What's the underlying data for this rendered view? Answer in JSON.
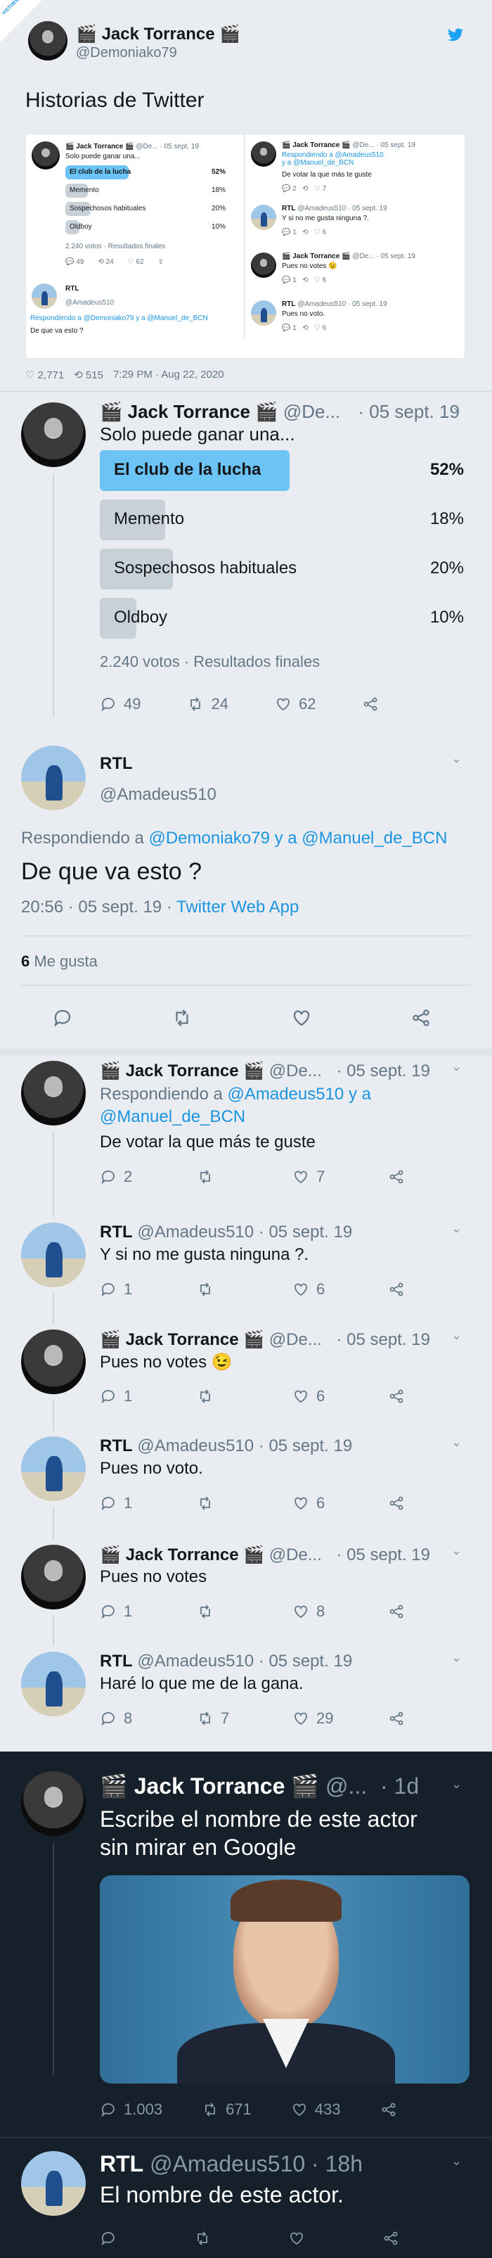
{
  "header": {
    "name": "Jack Torrance",
    "handle": "@Demoniako79",
    "title": "Historias de Twitter",
    "watermark": "VISTOENLASREDES"
  },
  "mini": {
    "left": {
      "name": "Jack Torrance",
      "handle": "@De...",
      "date": "· 05 sept. 19",
      "text": "Solo puede ganar una...",
      "opts": [
        "El club de la lucha",
        "Memento",
        "Sospechosos habituales",
        "Oldboy"
      ],
      "pcts": [
        "52%",
        "18%",
        "20%",
        "10%"
      ],
      "votes": "2.240 votos · Resultados finales",
      "r": "49",
      "rt": "24",
      "l": "62",
      "rtl_name": "RTL",
      "rtl_handle": "@Amadeus510",
      "reply_to": "Respondiendo a @Demoniako79 y a @Manuel_de_BCN",
      "reply_text": "De que va esto ?"
    },
    "right": [
      {
        "name": "Jack Torrance",
        "handle": "@De...",
        "date": "· 05 sept. 19",
        "reply": "Respondiendo a @Amadeus510 y a @Manuel_de_BCN",
        "text": "De votar la que más te guste",
        "r": "2",
        "l": "7"
      },
      {
        "name": "RTL",
        "handle": "@Amadeus510 · 05 sept. 19",
        "text": "Y si no me gusta ninguna ?.",
        "r": "1",
        "l": "6"
      },
      {
        "name": "Jack Torrance",
        "handle": "@De...",
        "date": "· 05 sept. 19",
        "text": "Pues no votes 😉",
        "r": "1",
        "l": "6"
      },
      {
        "name": "RTL",
        "handle": "@Amadeus510 · 05 sept. 19",
        "text": "Pues no voto.",
        "r": "1",
        "l": "6"
      }
    ],
    "stats": {
      "likes": "2,771",
      "rts": "515",
      "time": "7:29 PM · Aug 22, 2020"
    }
  },
  "main_tweet": {
    "name": "Jack Torrance",
    "handle": "@De...",
    "date": "· 05 sept. 19",
    "text": "Solo puede ganar una...",
    "poll": [
      {
        "label": "El club de la lucha",
        "pct": "52%",
        "value": 52
      },
      {
        "label": "Memento",
        "pct": "18%",
        "value": 18
      },
      {
        "label": "Sospechosos habituales",
        "pct": "20%",
        "value": 20
      },
      {
        "label": "Oldboy",
        "pct": "10%",
        "value": 10
      }
    ],
    "votes": "2.240 votos · Resultados finales",
    "replies": "49",
    "retweets": "24",
    "likes": "62"
  },
  "focus": {
    "name": "RTL",
    "handle": "@Amadeus510",
    "reply_prefix": "Respondiendo a",
    "reply_users": "@Demoniako79 y a @Manuel_de_BCN",
    "text": "De que va esto ?",
    "time": "20:56 · 05 sept. 19 ·",
    "app": "Twitter Web App",
    "likes_count": "6",
    "likes_label": "Me gusta"
  },
  "replies": [
    {
      "name": "Jack Torrance",
      "handle": "@De...",
      "date": "· 05 sept. 19",
      "reply_prefix": "Respondiendo a",
      "reply_users": "@Amadeus510 y a @Manuel_de_BCN",
      "text": "De votar la que más te guste",
      "r": "2",
      "rt": "",
      "l": "7"
    },
    {
      "name": "RTL",
      "handle": "@Amadeus510 · 05 sept. 19",
      "text": "Y si no me gusta ninguna ?.",
      "r": "1",
      "rt": "",
      "l": "6"
    },
    {
      "name": "Jack Torrance",
      "handle": "@De...",
      "date": "· 05 sept. 19",
      "text": "Pues no votes 😉",
      "r": "1",
      "rt": "",
      "l": "6"
    },
    {
      "name": "RTL",
      "handle": "@Amadeus510 · 05 sept. 19",
      "text": "Pues no voto.",
      "r": "1",
      "rt": "",
      "l": "6"
    },
    {
      "name": "Jack Torrance",
      "handle": "@De...",
      "date": "· 05 sept. 19",
      "text": "Pues no votes",
      "r": "1",
      "rt": "",
      "l": "8"
    },
    {
      "name": "RTL",
      "handle": "@Amadeus510 · 05 sept. 19",
      "text": "Haré lo que me de la gana.",
      "r": "8",
      "rt": "7",
      "l": "29"
    }
  ],
  "dark": {
    "t1": {
      "name": "Jack Torrance",
      "handle": "@...",
      "date": "· 1d",
      "text1": "Escribe el nombre de este actor",
      "text2": "sin mirar en Google",
      "r": "1.003",
      "rt": "671",
      "l": "433"
    },
    "t2": {
      "name": "RTL",
      "handle": "@Amadeus510 · 18h",
      "text": "El nombre de este actor."
    }
  },
  "colors": {
    "accent": "#1b95e0",
    "poll_win": "#6cc3f5",
    "poll_other": "#c9d1d8",
    "dark_bg": "#15202b"
  }
}
